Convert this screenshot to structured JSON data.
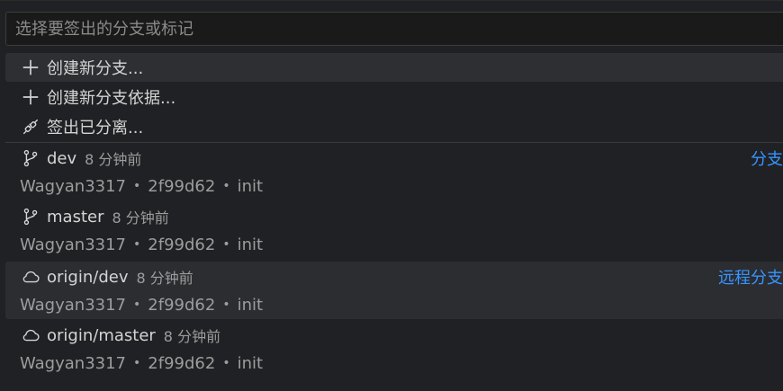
{
  "search": {
    "placeholder": "选择要签出的分支或标记",
    "value": ""
  },
  "actions": [
    {
      "label": "创建新分支...",
      "icon": "plus-icon"
    },
    {
      "label": "创建新分支依据...",
      "icon": "plus-icon"
    },
    {
      "label": "签出已分离...",
      "icon": "disconnected-plug-icon"
    }
  ],
  "refs": [
    {
      "name": "dev",
      "time": "8 分钟前",
      "author": "Wagyan3317",
      "commit": "2f99d62",
      "message": "init",
      "group_label": "分支",
      "icon": "git-branch-icon"
    },
    {
      "name": "master",
      "time": "8 分钟前",
      "author": "Wagyan3317",
      "commit": "2f99d62",
      "message": "init",
      "group_label": "",
      "icon": "git-branch-icon"
    },
    {
      "name": "origin/dev",
      "time": "8 分钟前",
      "author": "Wagyan3317",
      "commit": "2f99d62",
      "message": "init",
      "group_label": "远程分支",
      "icon": "cloud-icon"
    },
    {
      "name": "origin/master",
      "time": "8 分钟前",
      "author": "Wagyan3317",
      "commit": "2f99d62",
      "message": "init",
      "group_label": "",
      "icon": "cloud-icon"
    }
  ],
  "separator": "•",
  "colors": {
    "background": "#202124",
    "selected_row": "#2e2f33",
    "accent_label": "#3794ff",
    "text": "#d4d4d4",
    "muted_text": "#9d9d9d"
  }
}
